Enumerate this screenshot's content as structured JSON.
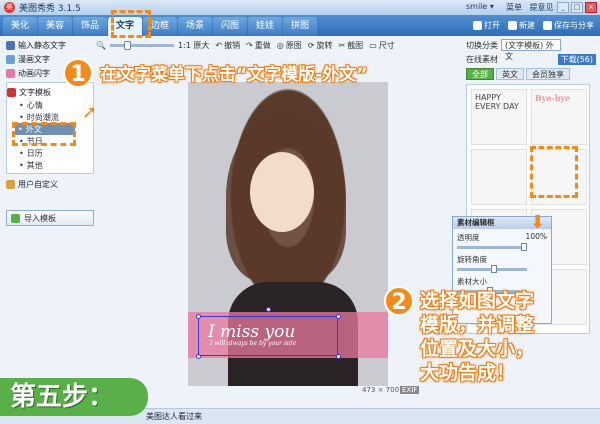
{
  "app": {
    "title": "美图秀秀 3.1.5",
    "account": "smile ▾",
    "links": [
      "菜单",
      "提意见"
    ]
  },
  "tabs": [
    "美化",
    "美容",
    "饰品",
    "文字",
    "边框",
    "场景",
    "闪图",
    "娃娃",
    "拼图"
  ],
  "active_tab": "文字",
  "menu_right": {
    "open": "打开",
    "new": "新建",
    "save": "保存与分享"
  },
  "sidebar": {
    "items": [
      "输入静态文字",
      "漫画文字",
      "动画闪字"
    ],
    "template_header": "文字模板",
    "template_subs": [
      "心情",
      "时尚潮流",
      "外文",
      "节日",
      "日历",
      "其他"
    ],
    "user_defined": "用户自定义",
    "import_button": "导入模板"
  },
  "toolbar": {
    "zoom_label": "1:1 原大",
    "items": [
      "撤销",
      "重做",
      "原图",
      "旋转",
      "截图",
      "尺寸"
    ]
  },
  "right_panel": {
    "switch_label": "切换分类",
    "category_value": "(文字模板) 外文",
    "online_label": "在线素材",
    "download_label": "下载(56)",
    "tabs": [
      "全部",
      "英文"
    ],
    "member_label": "会员独享",
    "thumb1": "HAPPY EVERY DAY",
    "thumb2": "Bye-bye"
  },
  "material_panel": {
    "title": "素材编辑框",
    "rows": [
      "透明度",
      "旋转角度",
      "素材大小"
    ],
    "opacity_value": "100%"
  },
  "canvas": {
    "main_text": "I miss you",
    "small_text": "I will always be by your side",
    "size": "473 × 700",
    "exif": "EXIF"
  },
  "statusbar": {
    "tip": "美图达人看过来"
  },
  "annotations": {
    "step1_num": "1",
    "step1_text": "在文字菜单下点击“文字模版-外文”",
    "step2_num": "2",
    "step2_line1": "选择如图文字",
    "step2_line2": "模版，并调整",
    "step2_line3": "位置及大小，",
    "step2_line4": "大功告成！",
    "step_badge": "第五步："
  },
  "colors": {
    "accent": "#f38b1c",
    "green": "#5ab048",
    "menu_blue": "#3d7cc4"
  }
}
